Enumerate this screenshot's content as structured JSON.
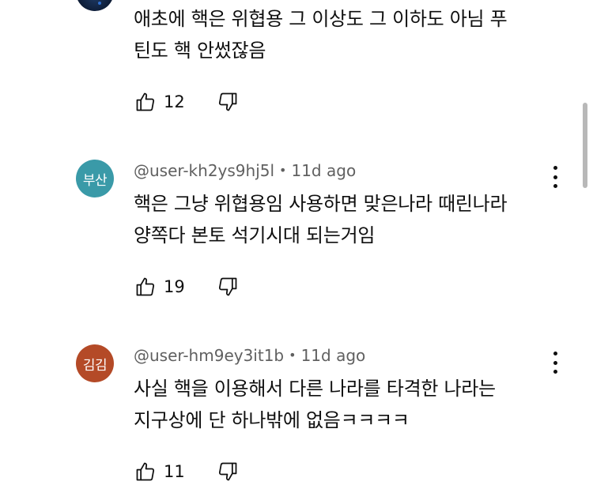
{
  "colors": {
    "avatar_busan": "#3a9aa8",
    "avatar_kimgim": "#b44a27",
    "meta_text": "#606060",
    "body_text": "#0f0f0f"
  },
  "comments": [
    {
      "author": "",
      "time": "",
      "avatar_text": "",
      "lines": [
        "애초에 핵은 위협용 그 이상도 그 이하도 아님 푸",
        "틴도 핵 안썼잖음"
      ],
      "likes": "12"
    },
    {
      "author": "@user-kh2ys9hj5l",
      "time": "11d ago",
      "avatar_text": "부산",
      "lines": [
        "핵은 그냥 위협용임 사용하면 맞은나라 때린나라",
        "양쪽다 본토 석기시대 되는거임"
      ],
      "likes": "19"
    },
    {
      "author": "@user-hm9ey3it1b",
      "time": "11d ago",
      "avatar_text": "김김",
      "lines": [
        "사실 핵을 이용해서 다른 나라를 타격한 나라는",
        "지구상에 단 하나밖에 없음ㅋㅋㅋㅋ"
      ],
      "likes": "11"
    }
  ],
  "meta_separator": "•",
  "icons": {
    "like": "thumb-up-icon",
    "dislike": "thumb-down-icon",
    "more": "more-vertical-icon"
  }
}
